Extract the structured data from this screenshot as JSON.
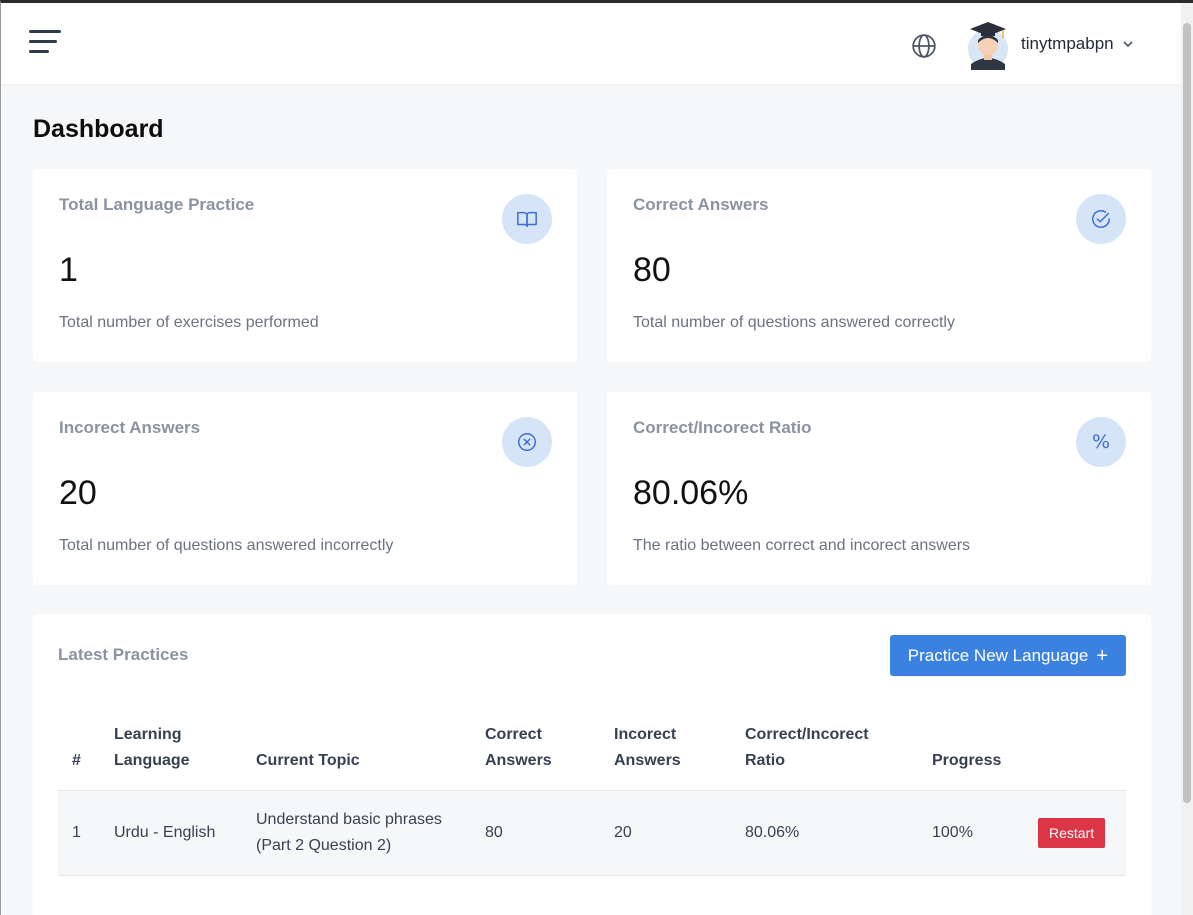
{
  "header": {
    "username": "tinytmpabpn"
  },
  "page_title": "Dashboard",
  "stats": [
    {
      "label": "Total Language Practice",
      "value": "1",
      "desc": "Total number of exercises performed",
      "icon": "book-open-icon"
    },
    {
      "label": "Correct Answers",
      "value": "80",
      "desc": "Total number of questions answered correctly",
      "icon": "check-circle-icon"
    },
    {
      "label": "Incorect Answers",
      "value": "20",
      "desc": "Total number of questions answered incorrectly",
      "icon": "x-circle-icon"
    },
    {
      "label": "Correct/Incorect Ratio",
      "value": "80.06%",
      "desc": "The ratio between correct and incorect answers",
      "icon": "percent-icon",
      "glyph": "%"
    }
  ],
  "practices": {
    "title": "Latest Practices",
    "new_button": "Practice New Language",
    "new_button_icon": "+",
    "columns": [
      "#",
      "Learning Language",
      "Current Topic",
      "Correct Answers",
      "Incorect Answers",
      "Correct/Incorect Ratio",
      "Progress",
      ""
    ],
    "rows": [
      {
        "num": "1",
        "language": "Urdu - English",
        "topic": "Understand basic phrases (Part 2 Question 2)",
        "correct": "80",
        "incorrect": "20",
        "ratio": "80.06%",
        "progress": "100%",
        "action": "Restart"
      }
    ]
  },
  "colors": {
    "primary": "#3b82e0",
    "danger": "#dc3545",
    "icon_badge": "#d6e4f7",
    "icon_stroke": "#3b6fd1"
  }
}
